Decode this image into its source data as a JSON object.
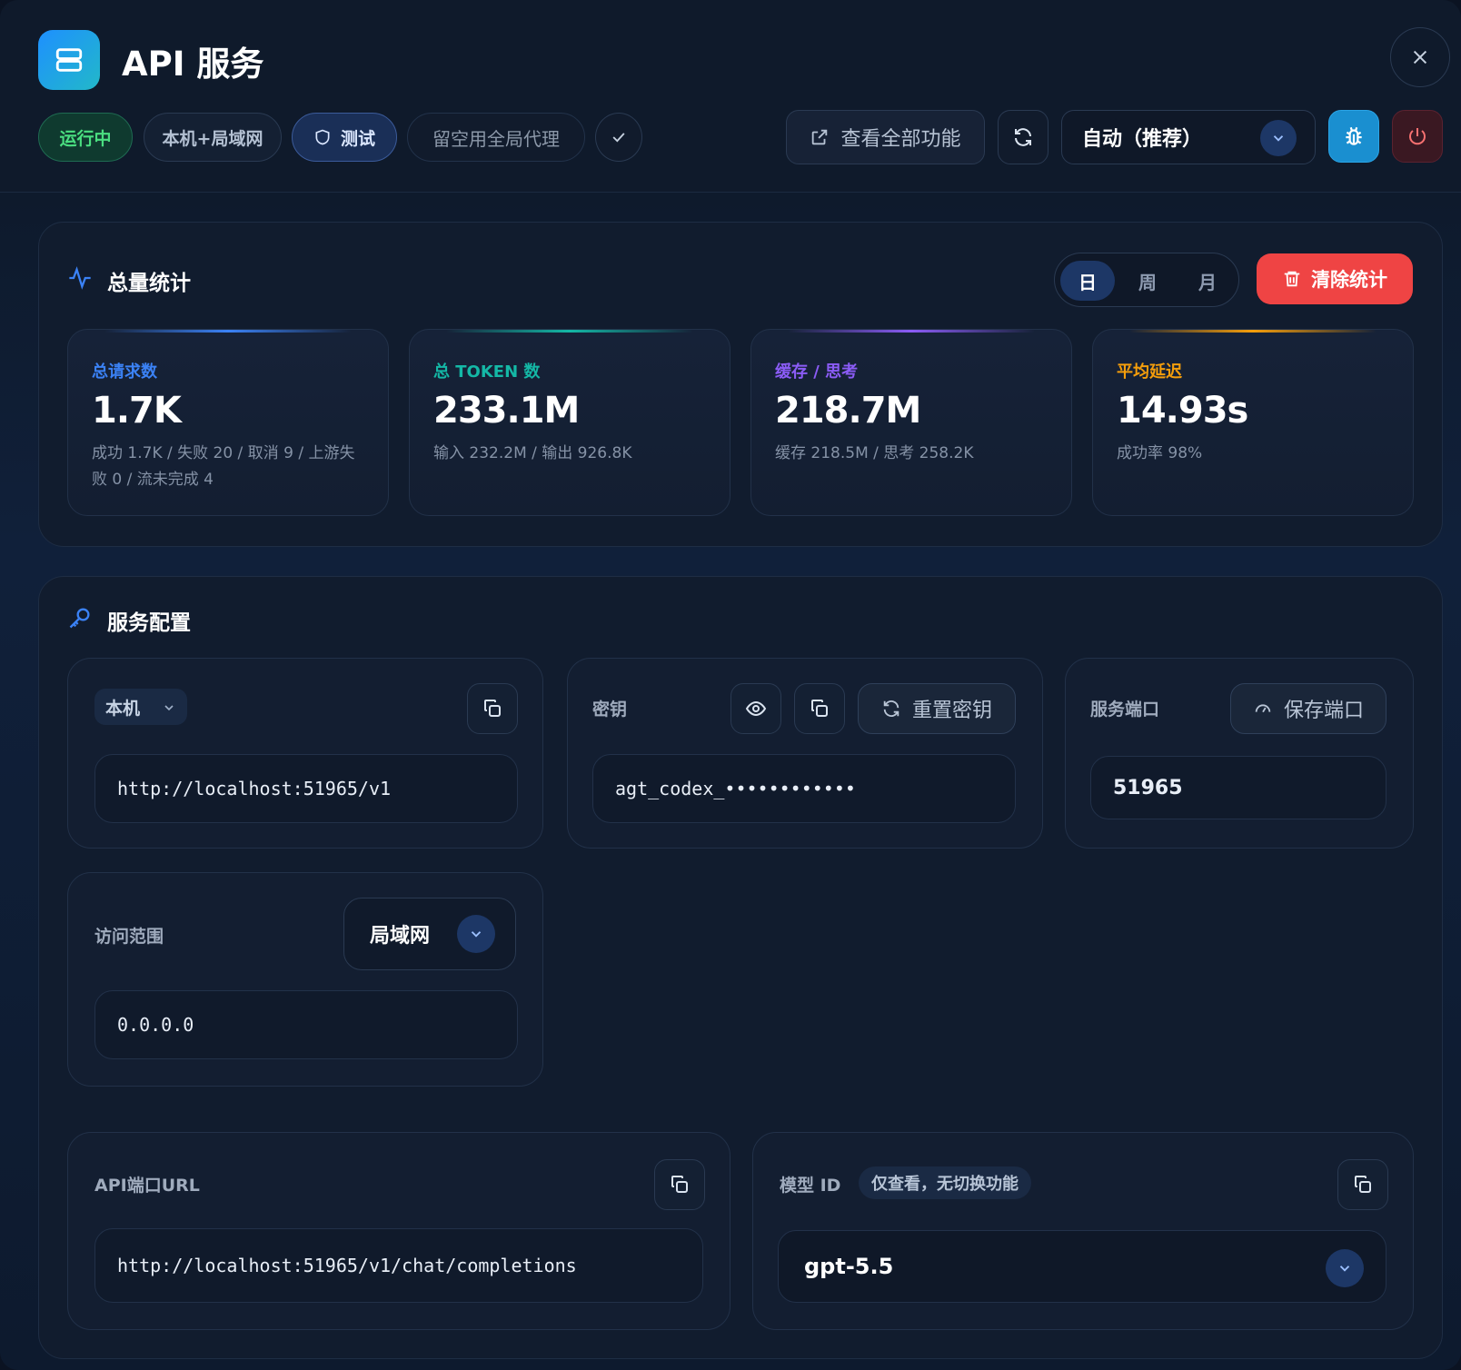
{
  "header": {
    "title": "API 服务",
    "status": {
      "running": "运行中",
      "scope": "本机+局域网",
      "test": "测试",
      "proxy_placeholder": "留空用全局代理"
    },
    "view_all_label": "查看全部功能",
    "mode_select": "自动（推荐）"
  },
  "stats": {
    "title": "总量统计",
    "periods": [
      "日",
      "周",
      "月"
    ],
    "active_period": "日",
    "clear_label": "清除统计",
    "cards": [
      {
        "label": "总请求数",
        "value": "1.7K",
        "detail": "成功 1.7K / 失败 20 / 取消 9 / 上游失败 0 / 流未完成 4",
        "color": "#3b82f6"
      },
      {
        "label": "总 TOKEN 数",
        "value": "233.1M",
        "detail": "输入 232.2M / 输出 926.8K",
        "color": "#14b8a6"
      },
      {
        "label": "缓存 / 思考",
        "value": "218.7M",
        "detail": "缓存 218.5M / 思考 258.2K",
        "color": "#8b5cf6"
      },
      {
        "label": "平均延迟",
        "value": "14.93s",
        "detail": "成功率 98%",
        "color": "#f59e0b"
      }
    ]
  },
  "config": {
    "title": "服务配置",
    "host_select": "本机",
    "base_url": "http://localhost:51965/v1",
    "key_label": "密钥",
    "key_value": "agt_codex_••••••••••••",
    "reset_key_label": "重置密钥",
    "port_label": "服务端口",
    "save_port_label": "保存端口",
    "port_value": "51965",
    "scope_label": "访问范围",
    "scope_select": "局域网",
    "scope_value": "0.0.0.0",
    "endpoint_label": "API端口URL",
    "endpoint_value": "http://localhost:51965/v1/chat/completions",
    "model_label": "模型 ID",
    "model_tag": "仅查看，无切换功能",
    "model_value": "gpt-5.5"
  }
}
